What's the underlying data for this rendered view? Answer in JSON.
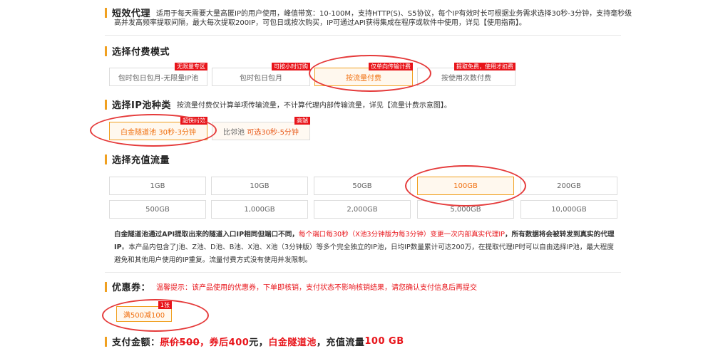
{
  "short_proxy": {
    "title": "短效代理",
    "desc_line1": "适用于每天需要大量高匿IP的用户使用，峰值带宽：10-100M，支持HTTP(S)、S5协议，每个IP有效时长可根据业务需求选择30秒-3分钟，支持毫秒级",
    "desc_line2": "高并发高频率提取间隔，最大每次提取200IP，可包日或按次购买，IP可通过API获得集成在程序或软件中使用，详见【使用指南】。"
  },
  "payment_mode": {
    "title": "选择付费模式",
    "options": [
      {
        "label": "包时包日包月-无限量IP池",
        "tag": "无限量专区"
      },
      {
        "label": "包时包日包月",
        "tag": "可按小时订购"
      },
      {
        "label": "按流量付费",
        "tag": "仅单向传输计费"
      },
      {
        "label": "按使用次数付费",
        "tag": "提取免费，使用才扣费"
      }
    ]
  },
  "ip_pool": {
    "title": "选择IP池种类",
    "desc": "按流量付费仅计算单项传输流量，不计算代理内部传输流量，详见【流量计费示意图】。",
    "options": [
      {
        "name": "白金隧道池",
        "detail": "30秒-3分钟",
        "tag": "超快时效"
      },
      {
        "name": "比邻池",
        "detail": "可选30秒-5分钟",
        "tag": "高端"
      }
    ]
  },
  "traffic": {
    "title": "选择充值流量",
    "row1": [
      "1GB",
      "10GB",
      "50GB",
      "100GB",
      "200GB"
    ],
    "row2": [
      "500GB",
      "1,000GB",
      "2,000GB",
      "5,000GB",
      "10,000GB"
    ]
  },
  "info": {
    "bold1": "白金隧道池通过API提取出来的隧道入口IP相同但端口不同，",
    "red": "每个端口每30秒（X池3分钟版为每3分钟）变更一次内部真实代理IP",
    "bold2": "，所有数据将会被转发到真实的代理",
    "bold3": "IP",
    "normal1": "。本产品内包含了J池、Z池、D池、B池、X池、X池（3分钟版）等多个完全独立的IP池，日均IP数量累计可达200万，在提取代理IP时可以自由选择IP池，最大程度",
    "normal2": "避免和其他用户使用的IP重复。流量付费方式没有使用并发限制。"
  },
  "coupon": {
    "title": "优惠券：",
    "tip": "温馨提示：该产品使用的优惠券，下单即核销，支付状态不影响核销结果，请您确认支付信息后再提交",
    "item": "满500减100",
    "tag": "1张"
  },
  "payment": {
    "label": "支付金额：",
    "orig": "原价500",
    "after": "，券后400",
    "unit": " 元，",
    "pool": "白金隧道池",
    "comma": "，",
    "traffic_label": "充值流量 ",
    "traffic_value": "100 GB"
  },
  "colors": {
    "accent": "#f0a020",
    "selected": "#f07010",
    "tag": "#e8141a",
    "circle": "#e53a3a"
  }
}
